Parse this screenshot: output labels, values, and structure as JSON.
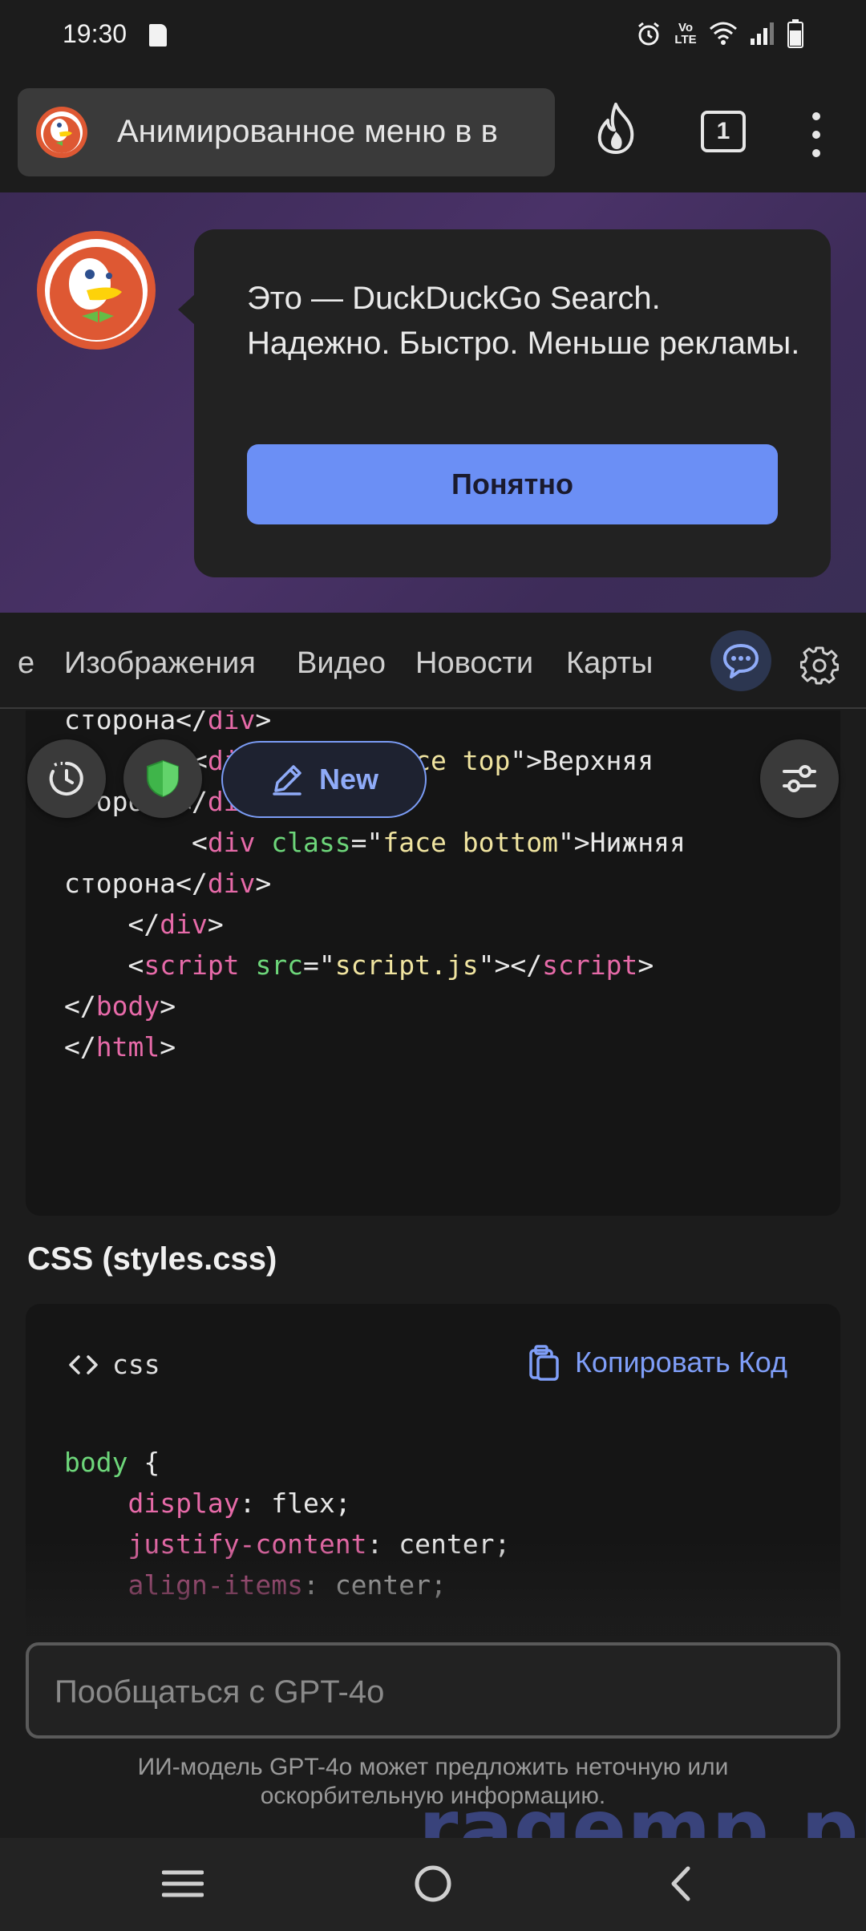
{
  "status_bar": {
    "time": "19:30",
    "volte_label": "Vo LTE",
    "icons": [
      "sd-card-icon",
      "alarm-icon",
      "volte-icon",
      "wifi-icon",
      "signal-icon",
      "battery-icon"
    ]
  },
  "toolbar": {
    "tab_title": "Анимированное меню в в",
    "tab_count": "1",
    "icons": [
      "duckduckgo-logo",
      "fire-icon",
      "tabs-icon",
      "overflow-menu-icon"
    ]
  },
  "promo": {
    "message": "Это — DuckDuckGo Search. Надежно. Быстро. Меньше рекламы.",
    "button_label": "Понятно"
  },
  "search_tabs": {
    "items": [
      {
        "label": "е"
      },
      {
        "label": "Изображения"
      },
      {
        "label": "Видео"
      },
      {
        "label": "Новости"
      },
      {
        "label": "Карты"
      }
    ]
  },
  "actions": {
    "new_label": "New"
  },
  "code_html": {
    "lines": [
      [
        {
          "t": "сторона</",
          "c": ""
        },
        {
          "t": "div",
          "c": "tag"
        },
        {
          "t": ">",
          "c": ""
        }
      ],
      [
        {
          "t": "        <",
          "c": ""
        },
        {
          "t": "div",
          "c": "tag"
        },
        {
          "t": " ",
          "c": ""
        },
        {
          "t": "class",
          "c": "attr"
        },
        {
          "t": "=\"",
          "c": ""
        },
        {
          "t": "face top",
          "c": "str"
        },
        {
          "t": "\">Верхняя",
          "c": ""
        }
      ],
      [
        {
          "t": "сторона</",
          "c": ""
        },
        {
          "t": "div",
          "c": "tag"
        },
        {
          "t": ">",
          "c": ""
        }
      ],
      [
        {
          "t": "        <",
          "c": ""
        },
        {
          "t": "div",
          "c": "tag"
        },
        {
          "t": " ",
          "c": ""
        },
        {
          "t": "class",
          "c": "attr"
        },
        {
          "t": "=\"",
          "c": ""
        },
        {
          "t": "face bottom",
          "c": "str"
        },
        {
          "t": "\">Нижняя",
          "c": ""
        }
      ],
      [
        {
          "t": "сторона</",
          "c": ""
        },
        {
          "t": "div",
          "c": "tag"
        },
        {
          "t": ">",
          "c": ""
        }
      ],
      [
        {
          "t": "    </",
          "c": ""
        },
        {
          "t": "div",
          "c": "tag"
        },
        {
          "t": ">",
          "c": ""
        }
      ],
      [
        {
          "t": "    <",
          "c": ""
        },
        {
          "t": "script",
          "c": "tag"
        },
        {
          "t": " ",
          "c": ""
        },
        {
          "t": "src",
          "c": "attr"
        },
        {
          "t": "=\"",
          "c": ""
        },
        {
          "t": "script.js",
          "c": "str"
        },
        {
          "t": "\"></",
          "c": ""
        },
        {
          "t": "script",
          "c": "tag"
        },
        {
          "t": ">",
          "c": ""
        }
      ],
      [
        {
          "t": "</",
          "c": ""
        },
        {
          "t": "body",
          "c": "tag"
        },
        {
          "t": ">",
          "c": ""
        }
      ],
      [
        {
          "t": "</",
          "c": ""
        },
        {
          "t": "html",
          "c": "tag"
        },
        {
          "t": ">",
          "c": ""
        }
      ]
    ]
  },
  "css_section": {
    "title": "CSS (styles.css)",
    "language": "css",
    "copy_label": "Копировать Код",
    "lines": [
      [
        {
          "t": "body",
          "c": "sel"
        },
        {
          "t": " {",
          "c": ""
        }
      ],
      [
        {
          "t": "    ",
          "c": ""
        },
        {
          "t": "display",
          "c": "prop"
        },
        {
          "t": ": flex;",
          "c": ""
        }
      ],
      [
        {
          "t": "    ",
          "c": ""
        },
        {
          "t": "justify-content",
          "c": "prop"
        },
        {
          "t": ": center;",
          "c": ""
        }
      ],
      [
        {
          "t": "    ",
          "c": ""
        },
        {
          "t": "align-items",
          "c": "prop"
        },
        {
          "t": ": center;",
          "c": ""
        }
      ]
    ]
  },
  "chat": {
    "placeholder": "Пообщаться с GPT-4o",
    "value": "",
    "disclaimer": "ИИ-модель GPT-4o может предложить неточную или оскорбительную информацию."
  },
  "watermark": "ragemp.pro",
  "nav_bar": {
    "icons": [
      "recent-apps-icon",
      "home-icon",
      "back-icon"
    ]
  },
  "colors": {
    "accent": "#6b8ff5",
    "background": "#1c1c1c",
    "code_tag": "#e66aa8",
    "code_attr": "#6dd67a",
    "code_string": "#f0e4a0"
  }
}
